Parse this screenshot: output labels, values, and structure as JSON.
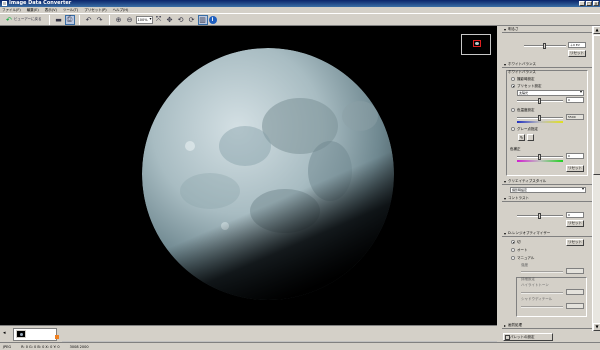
{
  "app": {
    "title": "Image Data Converter"
  },
  "window_buttons": [
    "_",
    "□",
    "×"
  ],
  "menu": [
    "ファイル(F)",
    "編集(E)",
    "表示(V)",
    "ツール(T)",
    "プリセット(P)",
    "ヘルプ(H)"
  ],
  "toolbar": {
    "viewer_back_label": "ビューアーに戻る",
    "zoom_value": "100%"
  },
  "icons": {
    "back": "↶",
    "save": "▬",
    "print": "⎙",
    "undo": "↶",
    "redo": "↷",
    "zoom_in": "⊕",
    "zoom_out": "⊖",
    "fit": "⤧",
    "hand": "✥",
    "rotate_left": "⟲",
    "rotate_right": "⟳",
    "compare": "▥",
    "info": "i"
  },
  "panel": {
    "exposure": {
      "title": "明るさ",
      "value": "＋0 EV",
      "reset": "リセット"
    },
    "white_balance": {
      "title": "ホワイトバランス",
      "group_label": "ホワイトバランス",
      "opt_as_shot": "撮影時設定",
      "opt_preset": "プリセット設定",
      "preset_value": "太陽光",
      "preset_fine": "0",
      "opt_temp": "色温度設定",
      "temp_value": "5500",
      "opt_gray": "グレー点指定",
      "cc_label": "色補正",
      "cc_value": "0",
      "reset": "リセット"
    },
    "creative_style": {
      "title": "クリエイティブスタイル",
      "value": "撮影時設定"
    },
    "contrast": {
      "title": "コントラスト",
      "value": "0",
      "reset": "リセット"
    },
    "dro": {
      "title": "D-レンジオプティマイザー",
      "opt_off": "切",
      "opt_auto": "オート",
      "opt_manual": "マニュアル",
      "reset": "リセット",
      "label_level": "強度",
      "label_highlight": "ハイライトトーン",
      "label_shadow": "シャドウディテール",
      "label_detail": "詳細設定"
    },
    "next_section": "画質処理",
    "apply_label": "パレットの設定"
  },
  "status": {
    "file": "JPEG",
    "pixel": "R: 0  G: 0  B: 0  X: 0  Y: 0",
    "size": "3008 2000"
  }
}
